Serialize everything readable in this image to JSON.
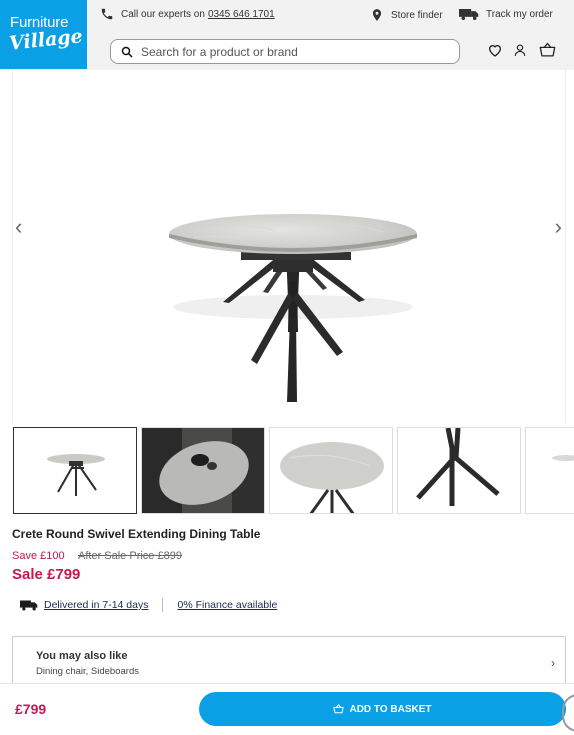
{
  "header": {
    "logo_line1": "Furniture",
    "logo_line2": "Village",
    "call_text": "Call our experts on",
    "call_number": "0345 646 1701",
    "store_finder": "Store finder",
    "track_order": "Track my order",
    "search_placeholder": "Search for a product or brand",
    "colors": {
      "logo_bg": "#0aa0e6",
      "bar_bg": "#f2f2f2"
    }
  },
  "gallery": {
    "prev_arrow": "‹",
    "next_arrow": "›",
    "thumbnail_count_visible": 5,
    "active_thumbnail": 1
  },
  "product": {
    "title": "Crete Round Swivel Extending Dining Table",
    "save_text": "Save £100",
    "after_sale_text": "After Sale Price £899",
    "sale_text": "Sale £799",
    "delivery_text": "Delivered in 7-14 days",
    "finance_text": "0% Finance available",
    "price_color": "#c8174f"
  },
  "also_like": {
    "heading": "You may also like",
    "items": "Dining chair, Sideboards",
    "chevron": "›"
  },
  "bottom_bar": {
    "price": "£799",
    "basket_label": "ADD TO BASKET",
    "button_color": "#0aa0e6"
  },
  "icons": [
    "phone-icon",
    "location-pin-icon",
    "truck-icon",
    "search-icon",
    "heart-icon",
    "user-icon",
    "basket-icon",
    "delivery-truck-icon",
    "chevron-right-icon"
  ]
}
